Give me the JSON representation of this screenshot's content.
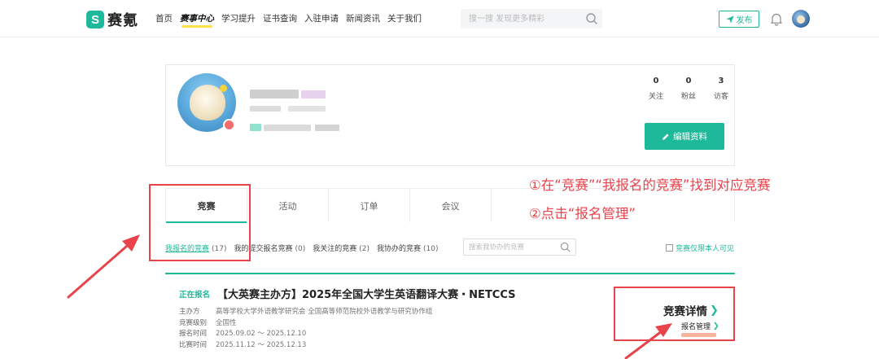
{
  "brand": {
    "logo_letter": "S",
    "name": "赛氪",
    "accent": "#1db99a"
  },
  "nav": {
    "items": [
      {
        "label": "首页",
        "active": false
      },
      {
        "label": "赛事中心",
        "active": true
      },
      {
        "label": "学习提升",
        "active": false
      },
      {
        "label": "证书查询",
        "active": false
      },
      {
        "label": "入驻申请",
        "active": false
      },
      {
        "label": "新闻资讯",
        "active": false
      },
      {
        "label": "关于我们",
        "active": false
      }
    ]
  },
  "search": {
    "placeholder": "搜一搜 发现更多精彩"
  },
  "header": {
    "publish_label": "发布"
  },
  "profile": {
    "stats": [
      {
        "value": "0",
        "label": "关注"
      },
      {
        "value": "0",
        "label": "粉丝"
      },
      {
        "value": "3",
        "label": "访客"
      }
    ],
    "edit_label": "编辑资料"
  },
  "annotations": {
    "line1": "①在“竞赛”“我报名的竞赛”找到对应竞赛",
    "line2": "②点击“报名管理”",
    "color": "#e8434b"
  },
  "tabs": [
    {
      "label": "竞赛",
      "active": true
    },
    {
      "label": "活动",
      "active": false
    },
    {
      "label": "订单",
      "active": false
    },
    {
      "label": "会议",
      "active": false
    }
  ],
  "filters": [
    {
      "label": "我报名的竞赛",
      "count": "(17)",
      "active": true
    },
    {
      "label": "我的提交报名竞赛",
      "count": "(0)",
      "active": false
    },
    {
      "label": "我关注的竞赛",
      "count": "(2)",
      "active": false
    },
    {
      "label": "我协办的竞赛",
      "count": "(10)",
      "active": false
    }
  ],
  "filter_search": {
    "placeholder": "搜索我协办的竞赛"
  },
  "only_me_label": "竞赛仅限本人可见",
  "competition": {
    "status": "正在报名",
    "title": "【大英赛主办方】2025年全国大学生英语翻译大赛・NETCCS",
    "meta": [
      {
        "label": "主办方",
        "value": "高等学校大学外语教学研究会 全国高等师范院校外语教学与研究协作组"
      },
      {
        "label": "竞赛级别",
        "value": "全国性"
      },
      {
        "label": "报名时间",
        "value": "2025.09.02 ～ 2025.12.10"
      },
      {
        "label": "比赛时间",
        "value": "2025.11.12 ～ 2025.12.13"
      }
    ],
    "detail_label": "竞赛详情",
    "manage_label": "报名管理"
  }
}
